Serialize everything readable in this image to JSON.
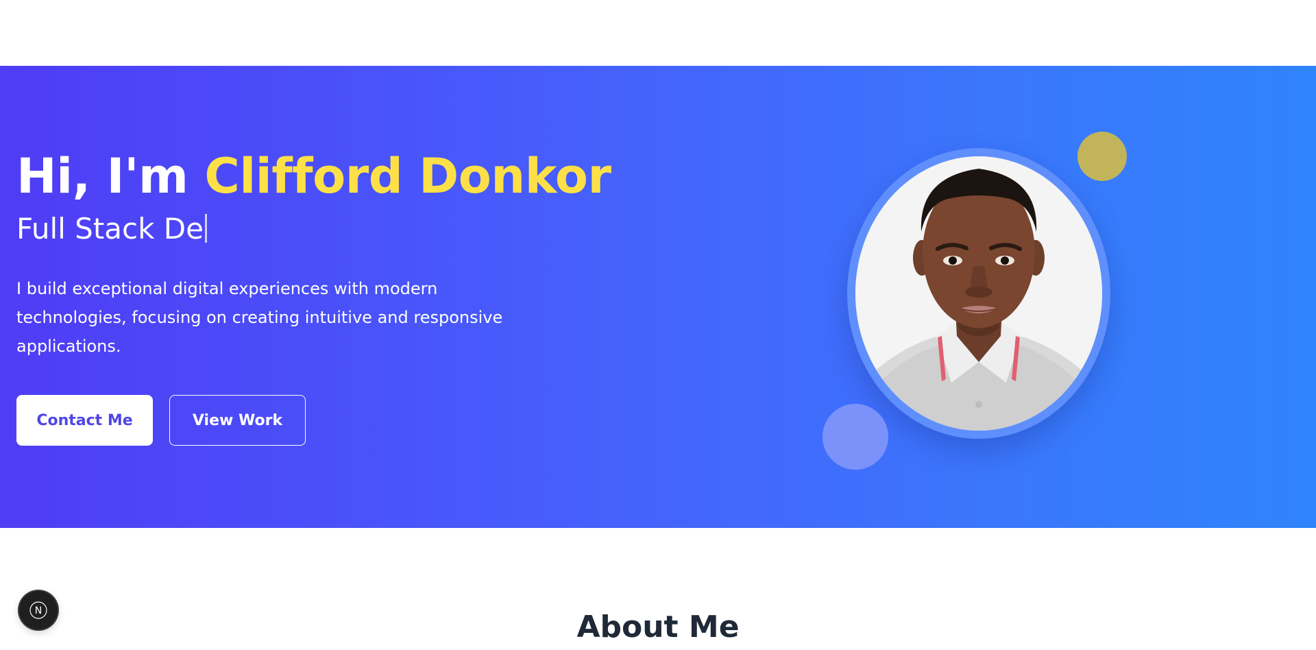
{
  "hero": {
    "greeting": "Hi, I'm ",
    "name": "Clifford Donkor",
    "typed_subtitle": "Full Stack De",
    "description": "I build exceptional digital experiences with modern technologies, focusing on creating intuitive and responsive applications.",
    "contact_button": "Contact Me",
    "work_button": "View Work",
    "colors": {
      "gradient_start": "#4f3cf5",
      "gradient_end": "#2f84fb",
      "name_highlight": "#fde047",
      "button_text": "#4f46e5"
    }
  },
  "about": {
    "title": "About Me"
  },
  "dev_badge": {
    "icon": "nextjs-n-icon",
    "letter": "N"
  }
}
